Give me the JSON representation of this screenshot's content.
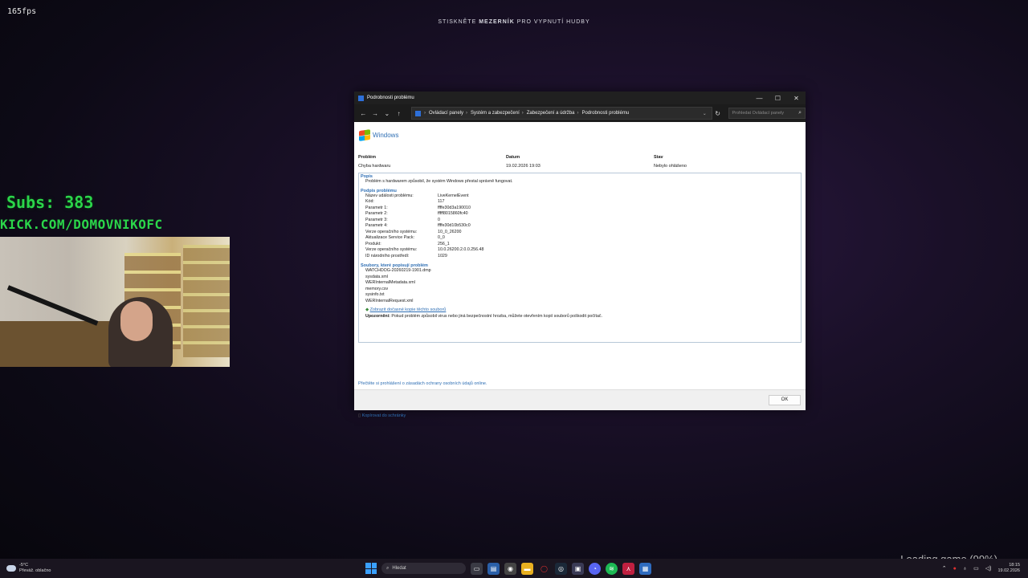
{
  "overlay": {
    "fps": "165fps",
    "hint_pre": "STISKNĚTE",
    "hint_key": "MEZERNÍK",
    "hint_post": "PRO VYPNUTÍ HUDBY",
    "subs": "Subs: 383",
    "kick": "KICK.COM/DOMOVNIKOFC",
    "loading": "Loading game (99%)"
  },
  "window": {
    "title": "Podrobnosti problému",
    "controls": {
      "minimize": "—",
      "maximize": "☐",
      "close": "✕"
    },
    "breadcrumbs": [
      "Ovládací panely",
      "Systém a zabezpečení",
      "Zabezpečení a údržba",
      "Podrobnosti problému"
    ],
    "search_placeholder": "Prohledat Ovládací panely",
    "logo_text": "Windows",
    "headers": {
      "problem": "Problém",
      "date": "Datum",
      "state": "Stav"
    },
    "values": {
      "problem": "Chyba hardwaru",
      "date": "19.02.2026 19:03",
      "state": "Nebylo ohlášeno"
    },
    "description_title": "Popis",
    "description": "Problém s hardwarem způsobil, že systém Windows přestal správně fungovat.",
    "signature_title": "Podpis problému",
    "signature": [
      {
        "k": "Název události problému:",
        "v": "LiveKernelEvent"
      },
      {
        "k": "Kód:",
        "v": "117"
      },
      {
        "k": "Parametr 1:",
        "v": "ffffe30d3a190010"
      },
      {
        "k": "Parametr 2:",
        "v": "fffff8015860fc40"
      },
      {
        "k": "Parametr 3:",
        "v": "0"
      },
      {
        "k": "Parametr 4:",
        "v": "ffffe30d10b530c0"
      },
      {
        "k": "Verze operačního systému:",
        "v": "10_0_26200"
      },
      {
        "k": "Aktualizace Service Pack:",
        "v": "0_0"
      },
      {
        "k": "Produkt:",
        "v": "256_1"
      },
      {
        "k": "Verze operačního systému:",
        "v": "10.0.26200.2.0.0.256.48"
      },
      {
        "k": "ID národního prostředí:",
        "v": "1029"
      }
    ],
    "files_title": "Soubory, které popisují problém",
    "files": [
      "WATCHDOG-20260219-1901.dmp",
      "sysdata.xml",
      "WERInternalMetadata.xml",
      "memory.csv",
      "sysinfo.txt",
      "WERInternalRequest.xml"
    ],
    "temp_link": "Zobrazit dočasné kopie těchto souborů",
    "warning_label": "Upozornění:",
    "warning_text": "Pokud problém způsobil virus nebo jiná bezpečnostní hrozba, můžete otevřením kopií souborů poškodit počítač.",
    "privacy_link": "Přečtěte si prohlášení o zásadách ochrany osobních údajů online.",
    "copy_link": "Kopírovat do schránky",
    "ok_label": "OK"
  },
  "taskbar": {
    "weather_temp": "-5°C",
    "weather_desc": "Převáž. oblačno",
    "search_label": "Hledat",
    "time": "18:15",
    "date": "19.02.2026"
  }
}
